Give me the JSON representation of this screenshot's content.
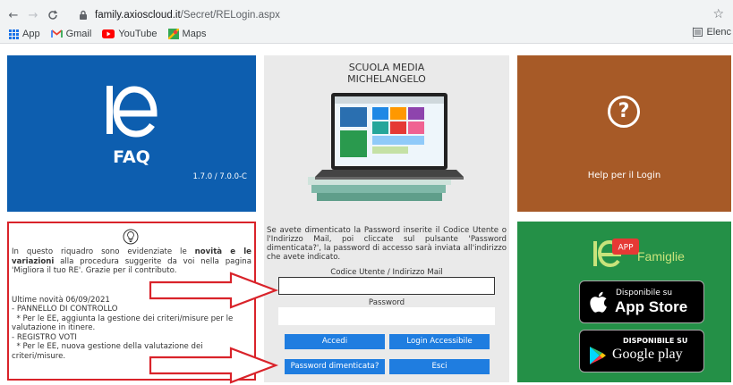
{
  "browser": {
    "url_host": "family.axioscloud.it",
    "url_path": "/Secret/RELogin.aspx",
    "bookmarks": [
      {
        "label": "App",
        "icon": "apps-grid-icon"
      },
      {
        "label": "Gmail",
        "icon": "gmail-icon"
      },
      {
        "label": "YouTube",
        "icon": "youtube-icon"
      },
      {
        "label": "Maps",
        "icon": "maps-icon"
      }
    ],
    "reading_list": "Elenc"
  },
  "faq_tile": {
    "logo": "re",
    "label": "FAQ",
    "version": "1.7.0 / 7.0.0-C",
    "color": "#0d5eaf"
  },
  "center": {
    "school_line1": "SCUOLA MEDIA",
    "school_line2": "MICHELANGELO"
  },
  "help_tile": {
    "icon": "question-icon",
    "label": "Help per il Login",
    "color": "#a75a27"
  },
  "info_box": {
    "intro_1": "In questo riquadro sono evidenziate le ",
    "intro_bold": "novità e le variazioni",
    "intro_2": " alla procedura suggerite da voi nella pagina 'Migliora il tuo RE'. Grazie per il contributo.",
    "news_title": "Ultime novità 06/09/2021",
    "item1": "- PANNELLO DI CONTROLLO",
    "item1_desc": "  * Per le EE, aggiunta la gestione dei criteri/misure per le valutazione in itinere.",
    "item2": "- REGISTRO VOTI",
    "item2_desc": "  * Per le EE, nuova gestione della valutazione dei criteri/misure."
  },
  "login": {
    "help_text": "Se avete dimenticato la Password inserite il Codice Utente o l'Indirizzo Mail, poi cliccate sul pulsante 'Password dimenticata?', la password di accesso sarà inviata all'indirizzo che avete indicato.",
    "user_label": "Codice Utente / Indirizzo Mail",
    "user_value": "",
    "password_label": "Password",
    "password_value": "",
    "btn_accedi": "Accedi",
    "btn_accessibile": "Login Accessibile",
    "btn_forgot": "Password dimenticata?",
    "btn_esci": "Esci",
    "button_color": "#1f7de0"
  },
  "app_tile": {
    "logo": "re",
    "badge": "APP",
    "brand": "Famiglie",
    "apple_line1": "Disponibile su",
    "apple_line2": "App Store",
    "google_line1": "DISPONIBILE SU",
    "google_line2": "Google play",
    "color": "#249047"
  }
}
